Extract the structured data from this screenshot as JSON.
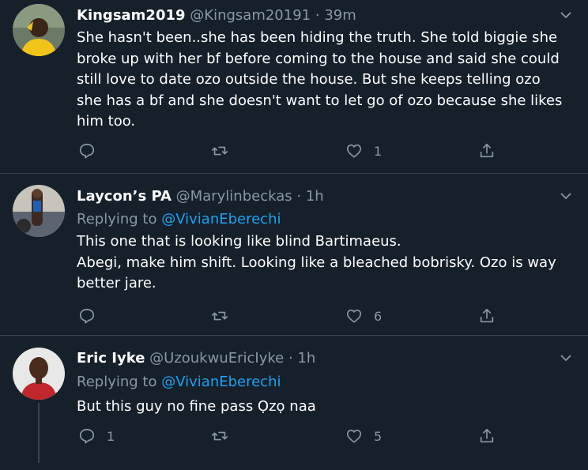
{
  "tweets": [
    {
      "name": "Kingsam2019",
      "handle": "@Kingsam20191",
      "sep": "·",
      "time": "39m",
      "text": "She hasn't been..she has been hiding the truth. She told biggie she broke up with her bf before coming to the house and said she could still love to date ozo outside the house. But she keeps telling ozo she has a bf and she doesn't want to let go of ozo because she likes him too.",
      "reply_count": "",
      "retweet_count": "",
      "like_count": "1"
    },
    {
      "name": "Laycon’s PA",
      "handle": "@Marylinbeckas",
      "sep": "·",
      "time": "1h",
      "replying_prefix": "Replying to",
      "replying_to": "@VivianEberechi",
      "text_line1": "This one that is looking like blind Bartimaeus.",
      "text_line2": "Abegi, make him shift. Looking like a bleached bobrisky. Ozo is way better jare.",
      "reply_count": "",
      "retweet_count": "",
      "like_count": "6"
    },
    {
      "name": "Eric Iyke",
      "handle": "@UzoukwuEricIyke",
      "sep": "·",
      "time": "1h",
      "replying_prefix": "Replying to",
      "replying_to": "@VivianEberechi",
      "text": "But this guy no fine pass Ọzọ naa",
      "reply_count": "1",
      "retweet_count": "",
      "like_count": "5"
    }
  ],
  "colors": {
    "background": "#15202b",
    "border": "#38444d",
    "muted": "#8899a6",
    "accent": "#1da1f2"
  },
  "icons": [
    "reply-icon",
    "retweet-icon",
    "like-icon",
    "share-icon",
    "chevron-down-icon"
  ]
}
